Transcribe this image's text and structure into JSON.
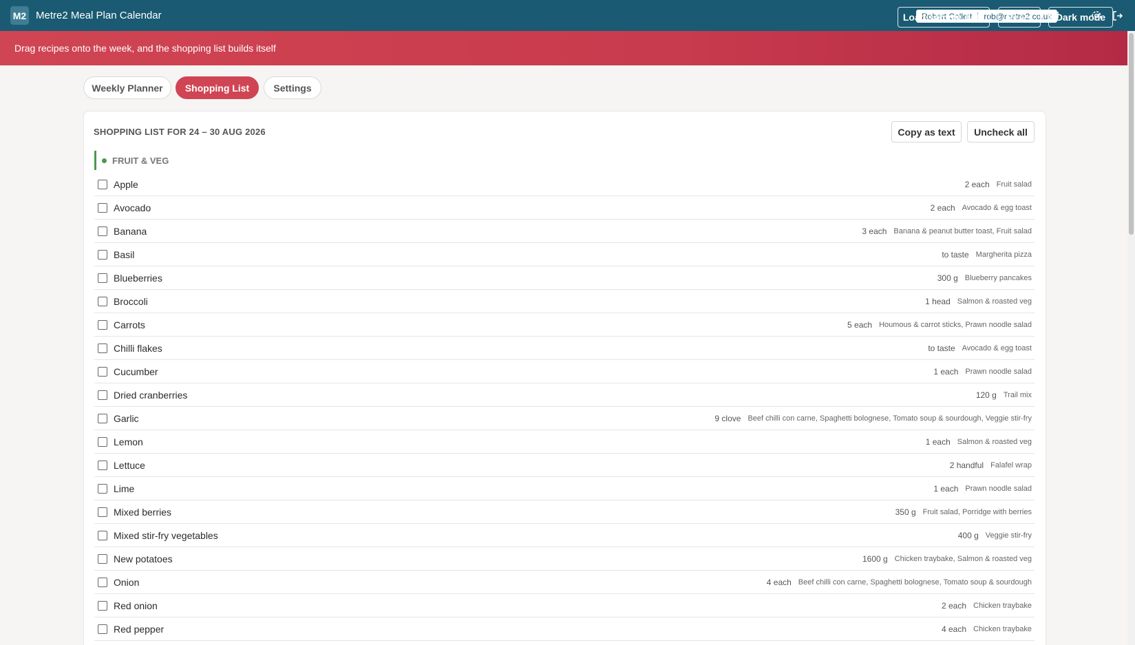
{
  "app": {
    "logo": "M2",
    "title": "Metre2 Meal Plan Calendar",
    "user_name": "Robert Collett",
    "user_email": "rob@metre2.co.uk",
    "icons": [
      "chat-icon",
      "settings-icon",
      "logout-icon"
    ]
  },
  "banner": {
    "text": "Drag recipes onto the week, and the shopping list builds itself",
    "load_label": "Load sample data",
    "reset_label": "Reset",
    "dark_label": "Dark mode"
  },
  "tabs": [
    {
      "label": "Weekly Planner",
      "active": false
    },
    {
      "label": "Shopping List",
      "active": true
    },
    {
      "label": "Settings",
      "active": false
    }
  ],
  "shopping": {
    "title": "SHOPPING LIST FOR 24 – 30 AUG 2026",
    "copy_label": "Copy as text",
    "uncheck_label": "Uncheck all",
    "category": "FRUIT & VEG",
    "category_color": "#4a9a4a",
    "items": [
      {
        "name": "Apple",
        "qty": "2 each",
        "recipes": "Fruit salad"
      },
      {
        "name": "Avocado",
        "qty": "2 each",
        "recipes": "Avocado & egg toast"
      },
      {
        "name": "Banana",
        "qty": "3 each",
        "recipes": "Banana & peanut butter toast, Fruit salad"
      },
      {
        "name": "Basil",
        "qty": "to taste",
        "recipes": "Margherita pizza"
      },
      {
        "name": "Blueberries",
        "qty": "300 g",
        "recipes": "Blueberry pancakes"
      },
      {
        "name": "Broccoli",
        "qty": "1 head",
        "recipes": "Salmon & roasted veg"
      },
      {
        "name": "Carrots",
        "qty": "5 each",
        "recipes": "Houmous & carrot sticks, Prawn noodle salad"
      },
      {
        "name": "Chilli flakes",
        "qty": "to taste",
        "recipes": "Avocado & egg toast"
      },
      {
        "name": "Cucumber",
        "qty": "1 each",
        "recipes": "Prawn noodle salad"
      },
      {
        "name": "Dried cranberries",
        "qty": "120 g",
        "recipes": "Trail mix"
      },
      {
        "name": "Garlic",
        "qty": "9 clove",
        "recipes": "Beef chilli con carne, Spaghetti bolognese, Tomato soup & sourdough, Veggie stir-fry"
      },
      {
        "name": "Lemon",
        "qty": "1 each",
        "recipes": "Salmon & roasted veg"
      },
      {
        "name": "Lettuce",
        "qty": "2 handful",
        "recipes": "Falafel wrap"
      },
      {
        "name": "Lime",
        "qty": "1 each",
        "recipes": "Prawn noodle salad"
      },
      {
        "name": "Mixed berries",
        "qty": "350 g",
        "recipes": "Fruit salad, Porridge with berries"
      },
      {
        "name": "Mixed stir-fry vegetables",
        "qty": "400 g",
        "recipes": "Veggie stir-fry"
      },
      {
        "name": "New potatoes",
        "qty": "1600 g",
        "recipes": "Chicken traybake, Salmon & roasted veg"
      },
      {
        "name": "Onion",
        "qty": "4 each",
        "recipes": "Beef chilli con carne, Spaghetti bolognese, Tomato soup & sourdough"
      },
      {
        "name": "Red onion",
        "qty": "2 each",
        "recipes": "Chicken traybake"
      },
      {
        "name": "Red pepper",
        "qty": "4 each",
        "recipes": "Chicken traybake"
      }
    ]
  },
  "colors": {
    "topbar": "#1a5a72",
    "banner": "#d04553",
    "accent": "#d04553"
  }
}
